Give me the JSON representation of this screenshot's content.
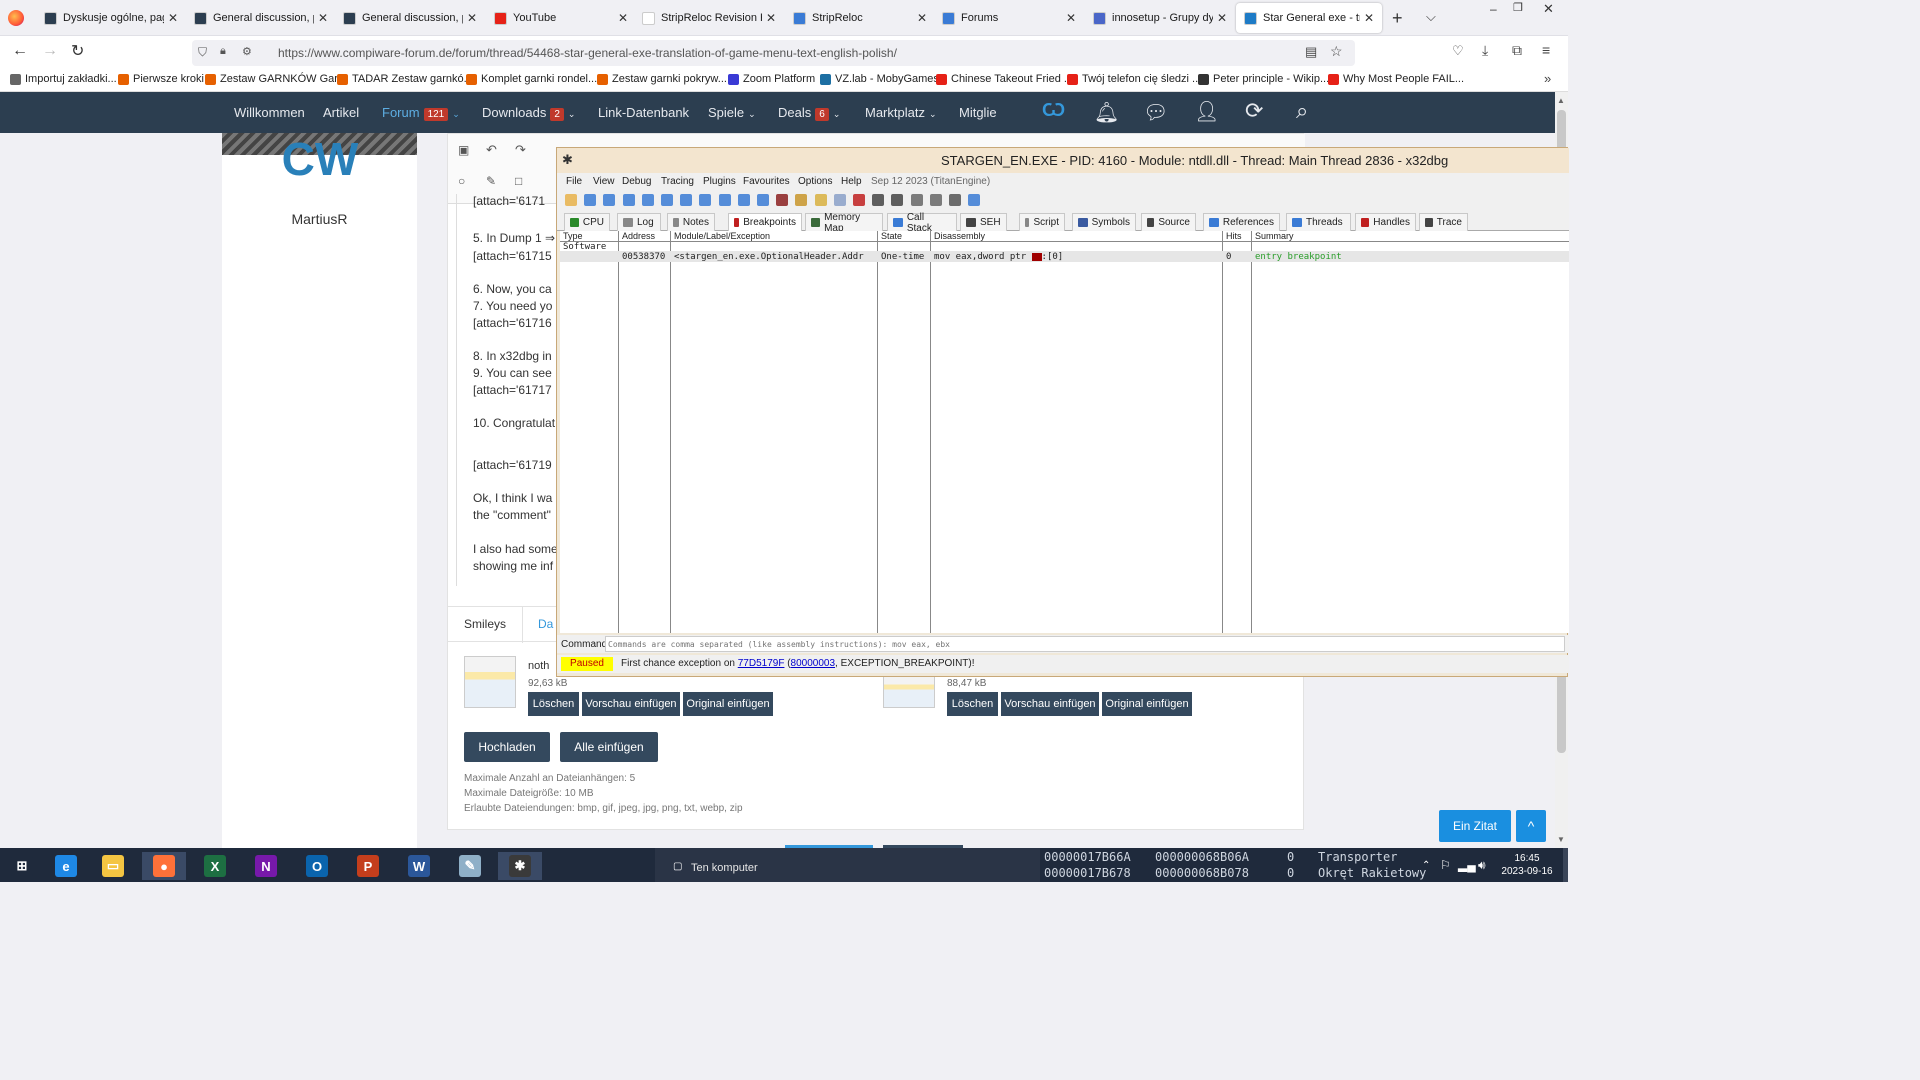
{
  "browser": {
    "tabs": [
      {
        "label": "Dyskusje ogólne, page",
        "icon_color": "#2c3e50",
        "active": false
      },
      {
        "label": "General discussion, pag",
        "icon_color": "#2c3e50",
        "active": false
      },
      {
        "label": "General discussion, pag",
        "icon_color": "#2c3e50",
        "active": false
      },
      {
        "label": "YouTube",
        "icon_color": "#e62117",
        "active": false
      },
      {
        "label": "StripReloc Revision History",
        "icon_color": "#ffffff",
        "active": false
      },
      {
        "label": "StripReloc",
        "icon_color": "#3a7bd5",
        "active": false
      },
      {
        "label": "Forums",
        "icon_color": "#3a7bd5",
        "active": false
      },
      {
        "label": "innosetup - Grupy dysk",
        "icon_color": "#4a66c8",
        "active": false
      },
      {
        "label": "Star General exe - transl",
        "icon_color": "#1e7bc6",
        "active": true
      }
    ],
    "url": "https://www.compiware-forum.de/forum/thread/54468-star-general-exe-translation-of-game-menu-text-english-polish/",
    "bookmarks": [
      {
        "label": "Importuj zakładki...",
        "color": "#666666"
      },
      {
        "label": "Pierwsze kroki",
        "color": "#e66000"
      },
      {
        "label": "Zestaw GARNKÓW Gar...",
        "color": "#e66000"
      },
      {
        "label": "TADAR Zestaw garnkó...",
        "color": "#e66000"
      },
      {
        "label": "Komplet garnki rondel...",
        "color": "#e66000"
      },
      {
        "label": "Zestaw garnki pokryw...",
        "color": "#e66000"
      },
      {
        "label": "Zoom Platform",
        "color": "#3a3ad5"
      },
      {
        "label": "VZ.lab - MobyGames",
        "color": "#1d6fa3"
      },
      {
        "label": "Chinese Takeout Fried ...",
        "color": "#e62117"
      },
      {
        "label": "Twój telefon cię śledzi ...",
        "color": "#e62117"
      },
      {
        "label": "Peter principle - Wikip...",
        "color": "#333333"
      },
      {
        "label": "Why Most People FAIL...",
        "color": "#e62117"
      }
    ]
  },
  "site": {
    "nav": [
      {
        "label": "Willkommen",
        "badge": ""
      },
      {
        "label": "Artikel",
        "badge": ""
      },
      {
        "label": "Forum",
        "badge": "121"
      },
      {
        "label": "Downloads",
        "badge": "2"
      },
      {
        "label": "Link-Datenbank",
        "badge": ""
      },
      {
        "label": "Spiele",
        "badge": ""
      },
      {
        "label": "Deals",
        "badge": "6"
      },
      {
        "label": "Marktplatz",
        "badge": ""
      },
      {
        "label": "Mitglie",
        "badge": ""
      }
    ],
    "logo_text": "CW",
    "username": "MartiusR",
    "content_lines": [
      "[attach='6171",
      "5. In Dump 1 ⇒",
      "[attach='61715",
      "6. Now, you ca",
      "7. You need yo",
      "[attach='61716",
      "8. In x32dbg in",
      "9. You can see",
      "[attach='61717",
      "10. Congratulat",
      "[attach='61719",
      "Ok, I think I wa",
      "the \"comment\"",
      "I also had some",
      "showing me inf"
    ],
    "tabs": [
      "Smileys",
      "Da"
    ],
    "attachments": [
      {
        "name": "noth",
        "size": "92,63 kB"
      },
      {
        "name": "",
        "size": "88,47 kB"
      }
    ],
    "attach_buttons": [
      "Löschen",
      "Vorschau einfügen",
      "Original einfügen"
    ],
    "upload_button": "Hochladen",
    "insert_all_button": "Alle einfügen",
    "limits": [
      "Maximale Anzahl an Dateianhängen: 5",
      "Maximale Dateigröße: 10 MB",
      "Erlaubte Dateiendungen: bmp, gif, jpeg, jpg, png, txt, webp, zip"
    ],
    "quote_button": "Ein Zitat",
    "scroll_top": "^"
  },
  "debugger": {
    "title": "STARGEN_EN.EXE - PID: 4160 - Module: ntdll.dll - Thread: Main Thread 2836 - x32dbg",
    "menu": [
      "File",
      "View",
      "Debug",
      "Tracing",
      "Plugins",
      "Favourites",
      "Options",
      "Help"
    ],
    "build": "Sep 12 2023 (TitanEngine)",
    "tabs": [
      "CPU",
      "Log",
      "Notes",
      "Breakpoints",
      "Memory Map",
      "Call Stack",
      "SEH",
      "Script",
      "Symbols",
      "Source",
      "References",
      "Threads",
      "Handles",
      "Trace"
    ],
    "active_tab": "Breakpoints",
    "columns": [
      "Type",
      "Address",
      "Module/Label/Exception",
      "State",
      "Disassembly",
      "Hits",
      "Summary"
    ],
    "group_row": "Software",
    "row": {
      "address": "00538370",
      "module": "<stargen_en.exe.OptionalHeader.Addr",
      "state": "One-time",
      "disasm": "mov eax,dword ptr ",
      "disasm_tail": ":[0]",
      "hits": "0",
      "summary": "entry breakpoint"
    },
    "command_label": "Command:",
    "command_placeholder": "Commands are comma separated (like assembly instructions): mov eax, ebx",
    "status_state": "Paused",
    "status_pre": "First chance exception on ",
    "status_addr": "77D5179F",
    "status_mid": " (",
    "status_code": "80000003",
    "status_post": ", EXCEPTION_BREAKPOINT)!"
  },
  "taskbar": {
    "apps": [
      {
        "name": "start-icon",
        "color": "#1f2a3c",
        "glyph": "⊞"
      },
      {
        "name": "internet-explorer-icon",
        "color": "#1e88e5",
        "glyph": "e"
      },
      {
        "name": "file-explorer-icon",
        "color": "#f4c542",
        "glyph": "▭"
      },
      {
        "name": "firefox-icon",
        "color": "#ff7139",
        "glyph": "●"
      },
      {
        "name": "excel-icon",
        "color": "#1d6f42",
        "glyph": "X"
      },
      {
        "name": "onenote-icon",
        "color": "#7719aa",
        "glyph": "N"
      },
      {
        "name": "outlook-icon",
        "color": "#0a64ad",
        "glyph": "O"
      },
      {
        "name": "powerpoint-icon",
        "color": "#c43e1c",
        "glyph": "P"
      },
      {
        "name": "word-icon",
        "color": "#2b579a",
        "glyph": "W"
      },
      {
        "name": "notepad-icon",
        "color": "#8fb0c8",
        "glyph": "✎"
      },
      {
        "name": "x32dbg-icon",
        "color": "#3a3a3a",
        "glyph": "✱"
      }
    ],
    "window_label": "Ten komputer",
    "table_rows": [
      [
        "00000017B66A",
        "000000068B06A",
        "0",
        "Transporter"
      ],
      [
        "00000017B678",
        "000000068B078",
        "0",
        "Okręt Rakietowy"
      ]
    ],
    "time": "16:45",
    "date": "2023-09-16"
  }
}
